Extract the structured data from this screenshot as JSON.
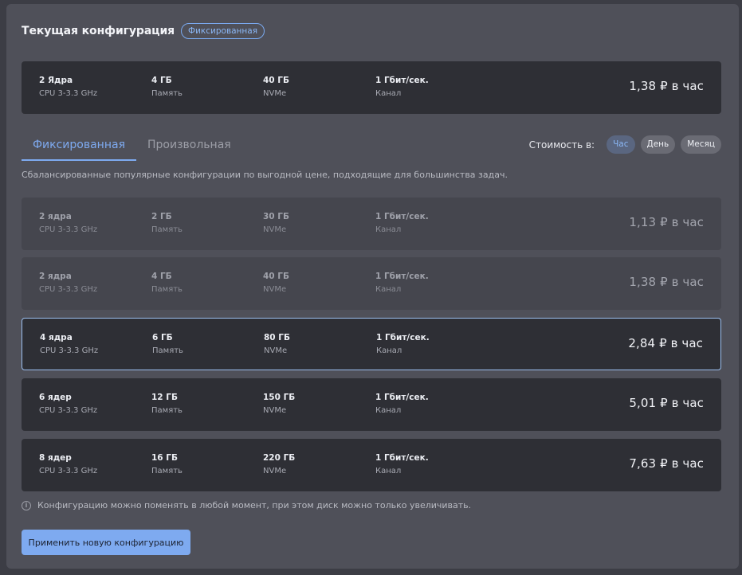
{
  "header": {
    "title": "Текущая конфигурация",
    "badge": "Фиксированная"
  },
  "current": {
    "cores": "2 Ядра",
    "cpu": "CPU 3-3.3 GHz",
    "ram": "4 ГБ",
    "ram_label": "Память",
    "disk": "40 ГБ",
    "disk_label": "NVMe",
    "net": "1 Гбит/сек.",
    "net_label": "Канал",
    "price": "1,38 ₽ в час"
  },
  "tabs": [
    {
      "label": "Фиксированная",
      "active": true
    },
    {
      "label": "Произвольная",
      "active": false
    }
  ],
  "cost": {
    "label": "Стоимость в:",
    "options": [
      {
        "label": "Час",
        "active": true
      },
      {
        "label": "День",
        "active": false
      },
      {
        "label": "Месяц",
        "active": false
      }
    ]
  },
  "description": "Сбалансированные популярные конфигурации по выгодной цене, подходящие для большинства задач.",
  "configs": [
    {
      "cores": "2 ядра",
      "cpu": "CPU 3-3.3 GHz",
      "ram": "2 ГБ",
      "ram_label": "Память",
      "disk": "30 ГБ",
      "disk_label": "NVMe",
      "net": "1 Гбит/сек.",
      "net_label": "Канал",
      "price": "1,13 ₽ в час",
      "state": "disabled"
    },
    {
      "cores": "2 ядра",
      "cpu": "CPU 3-3.3 GHz",
      "ram": "4 ГБ",
      "ram_label": "Память",
      "disk": "40 ГБ",
      "disk_label": "NVMe",
      "net": "1 Гбит/сек.",
      "net_label": "Канал",
      "price": "1,38 ₽ в час",
      "state": "disabled"
    },
    {
      "cores": "4 ядра",
      "cpu": "CPU 3-3.3 GHz",
      "ram": "6 ГБ",
      "ram_label": "Память",
      "disk": "80 ГБ",
      "disk_label": "NVMe",
      "net": "1 Гбит/сек.",
      "net_label": "Канал",
      "price": "2,84 ₽ в час",
      "state": "selected"
    },
    {
      "cores": "6 ядер",
      "cpu": "CPU 3-3.3 GHz",
      "ram": "12 ГБ",
      "ram_label": "Память",
      "disk": "150 ГБ",
      "disk_label": "NVMe",
      "net": "1 Гбит/сек.",
      "net_label": "Канал",
      "price": "5,01 ₽ в час",
      "state": "available"
    },
    {
      "cores": "8 ядер",
      "cpu": "CPU 3-3.3 GHz",
      "ram": "16 ГБ",
      "ram_label": "Память",
      "disk": "220 ГБ",
      "disk_label": "NVMe",
      "net": "1 Гбит/сек.",
      "net_label": "Канал",
      "price": "7,63 ₽ в час",
      "state": "available"
    }
  ],
  "note": {
    "icon": "info-icon",
    "text": "Конфигурацию можно поменять в любой момент, при этом диск можно только увеличивать."
  },
  "apply_button": "Применить новую конфигурацию",
  "colors": {
    "accent": "#7eaaf0",
    "panel": "#4f5059",
    "card": "#2e2f35",
    "card_disabled": "#45464e"
  }
}
